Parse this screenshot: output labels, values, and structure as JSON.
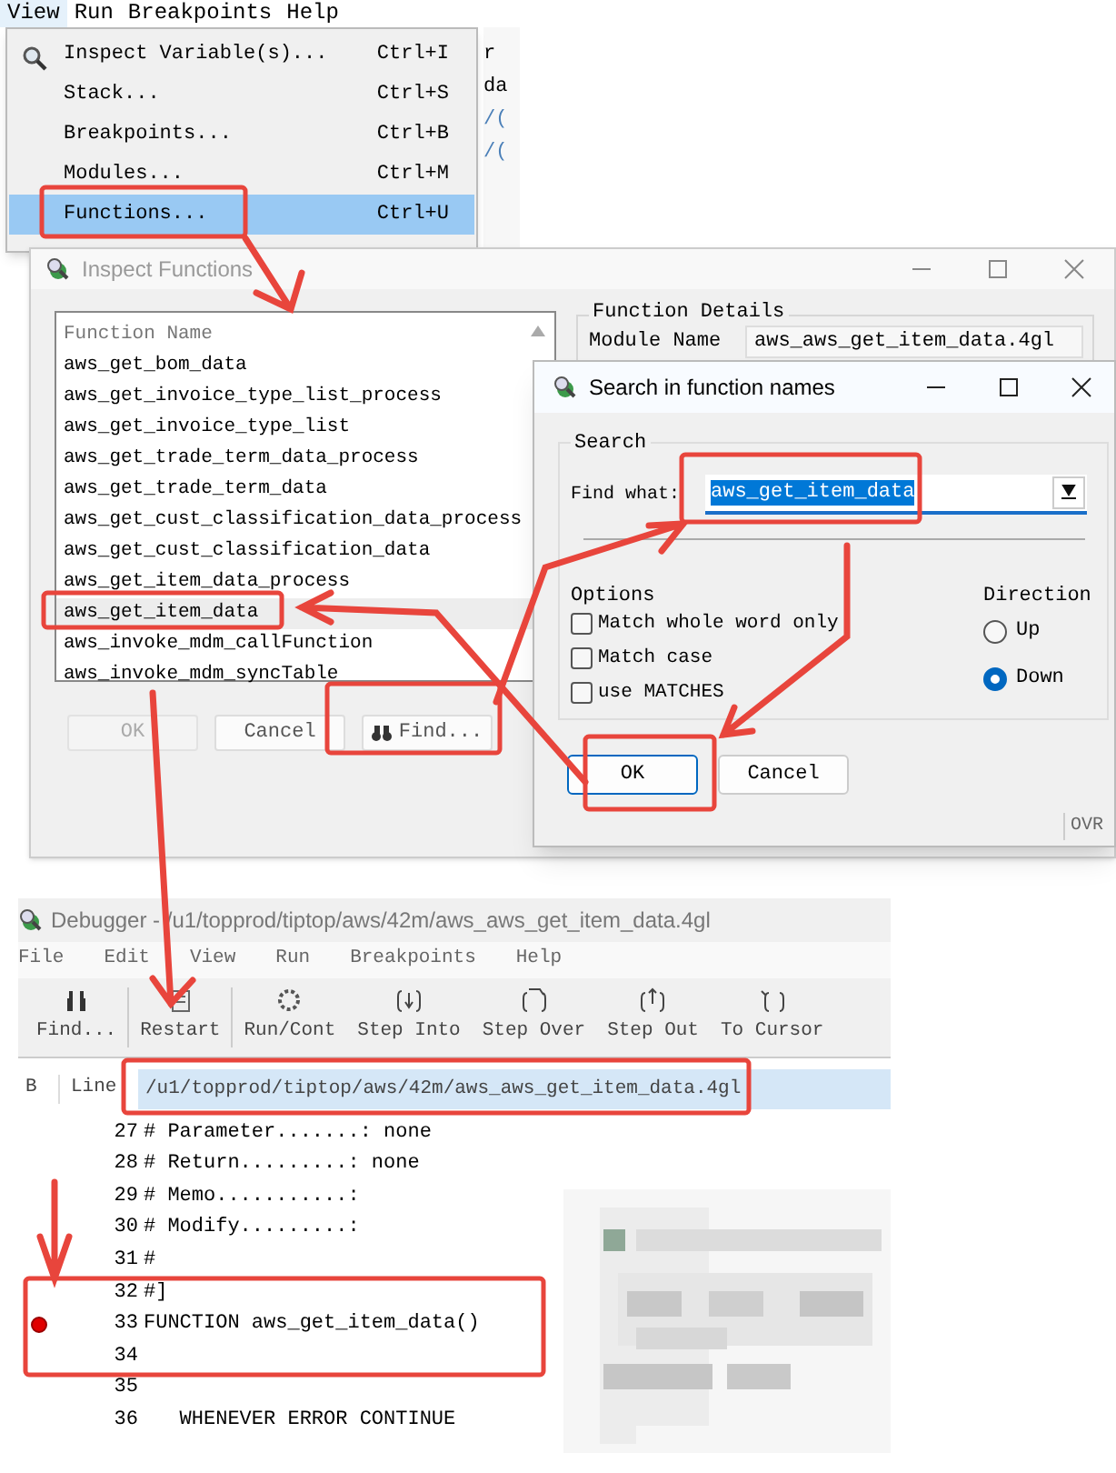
{
  "main_menu": [
    {
      "label": "View",
      "selected": true
    },
    {
      "label": "Run",
      "selected": false
    },
    {
      "label": "Breakpoints",
      "selected": false
    },
    {
      "label": "Help",
      "selected": false
    }
  ],
  "background_fragments": [
    "r",
    "da",
    "/(",
    "/("
  ],
  "view_menu": [
    {
      "label": "Inspect Variable(s)...",
      "shortcut": "Ctrl+I",
      "selected": false
    },
    {
      "label": "Stack...",
      "shortcut": "Ctrl+S",
      "selected": false
    },
    {
      "label": "Breakpoints...",
      "shortcut": "Ctrl+B",
      "selected": false
    },
    {
      "label": "Modules...",
      "shortcut": "Ctrl+M",
      "selected": false
    },
    {
      "label": "Functions...",
      "shortcut": "Ctrl+U",
      "selected": true
    }
  ],
  "inspect_functions": {
    "title": "Inspect Functions",
    "list_header": "Function Name",
    "functions": [
      {
        "label": "aws_get_bom_data",
        "selected": false
      },
      {
        "label": "aws_get_invoice_type_list_process",
        "selected": false
      },
      {
        "label": "aws_get_invoice_type_list",
        "selected": false
      },
      {
        "label": "aws_get_trade_term_data_process",
        "selected": false
      },
      {
        "label": "aws_get_trade_term_data",
        "selected": false
      },
      {
        "label": "aws_get_cust_classification_data_process",
        "selected": false
      },
      {
        "label": "aws_get_cust_classification_data",
        "selected": false
      },
      {
        "label": "aws_get_item_data_process",
        "selected": false
      },
      {
        "label": "aws_get_item_data",
        "selected": true
      },
      {
        "label": "aws_invoke_mdm_callFunction",
        "selected": false
      },
      {
        "label": "aws_invoke_mdm_syncTable",
        "selected": false
      }
    ],
    "buttons": [
      {
        "label": "OK",
        "disabled": true
      },
      {
        "label": "Cancel",
        "disabled": false
      },
      {
        "label": "Find...",
        "disabled": false
      }
    ],
    "details_title": "Function Details",
    "module_label": "Module Name",
    "module_value": "aws_aws_get_item_data.4gl"
  },
  "search_dialog": {
    "title": "Search in function names",
    "group": "Search",
    "find_label": "Find what:",
    "find_value": "aws_get_item_data",
    "options_title": "Options",
    "options": [
      {
        "label": "Match whole word only",
        "checked": false
      },
      {
        "label": "Match case",
        "checked": false
      },
      {
        "label": "use MATCHES",
        "checked": false
      }
    ],
    "direction_title": "Direction",
    "directions": [
      {
        "label": "Up",
        "selected": false
      },
      {
        "label": "Down",
        "selected": true
      }
    ],
    "buttons": [
      "OK",
      "Cancel"
    ],
    "status": "OVR"
  },
  "debugger": {
    "title": "Debugger - /u1/topprod/tiptop/aws/42m/aws_aws_get_item_data.4gl",
    "menu": [
      "File",
      "Edit",
      "View",
      "Run",
      "Breakpoints",
      "Help"
    ],
    "toolbar": [
      "Find...",
      "Restart",
      "Run/Cont",
      "Step Into",
      "Step Over",
      "Step Out",
      "To Cursor"
    ],
    "columns": [
      "B",
      "Line"
    ],
    "file_path": "/u1/topprod/tiptop/aws/42m/aws_aws_get_item_data.4gl",
    "lines": [
      {
        "number": "27",
        "text": "# Parameter.......: none",
        "breakpoint": false
      },
      {
        "number": "28",
        "text": "# Return.........: none",
        "breakpoint": false
      },
      {
        "number": "29",
        "text": "# Memo...........:",
        "breakpoint": false
      },
      {
        "number": "30",
        "text": "# Modify.........:",
        "breakpoint": false
      },
      {
        "number": "31",
        "text": "#",
        "breakpoint": false
      },
      {
        "number": "32",
        "text": "#]",
        "breakpoint": false
      },
      {
        "number": "33",
        "text": "FUNCTION aws_get_item_data()",
        "breakpoint": true
      },
      {
        "number": "34",
        "breakpoint": false
      },
      {
        "number": "35",
        "breakpoint": false
      },
      {
        "number": "36",
        "text": "   WHENEVER ERROR CONTINUE",
        "breakpoint": false
      }
    ]
  }
}
